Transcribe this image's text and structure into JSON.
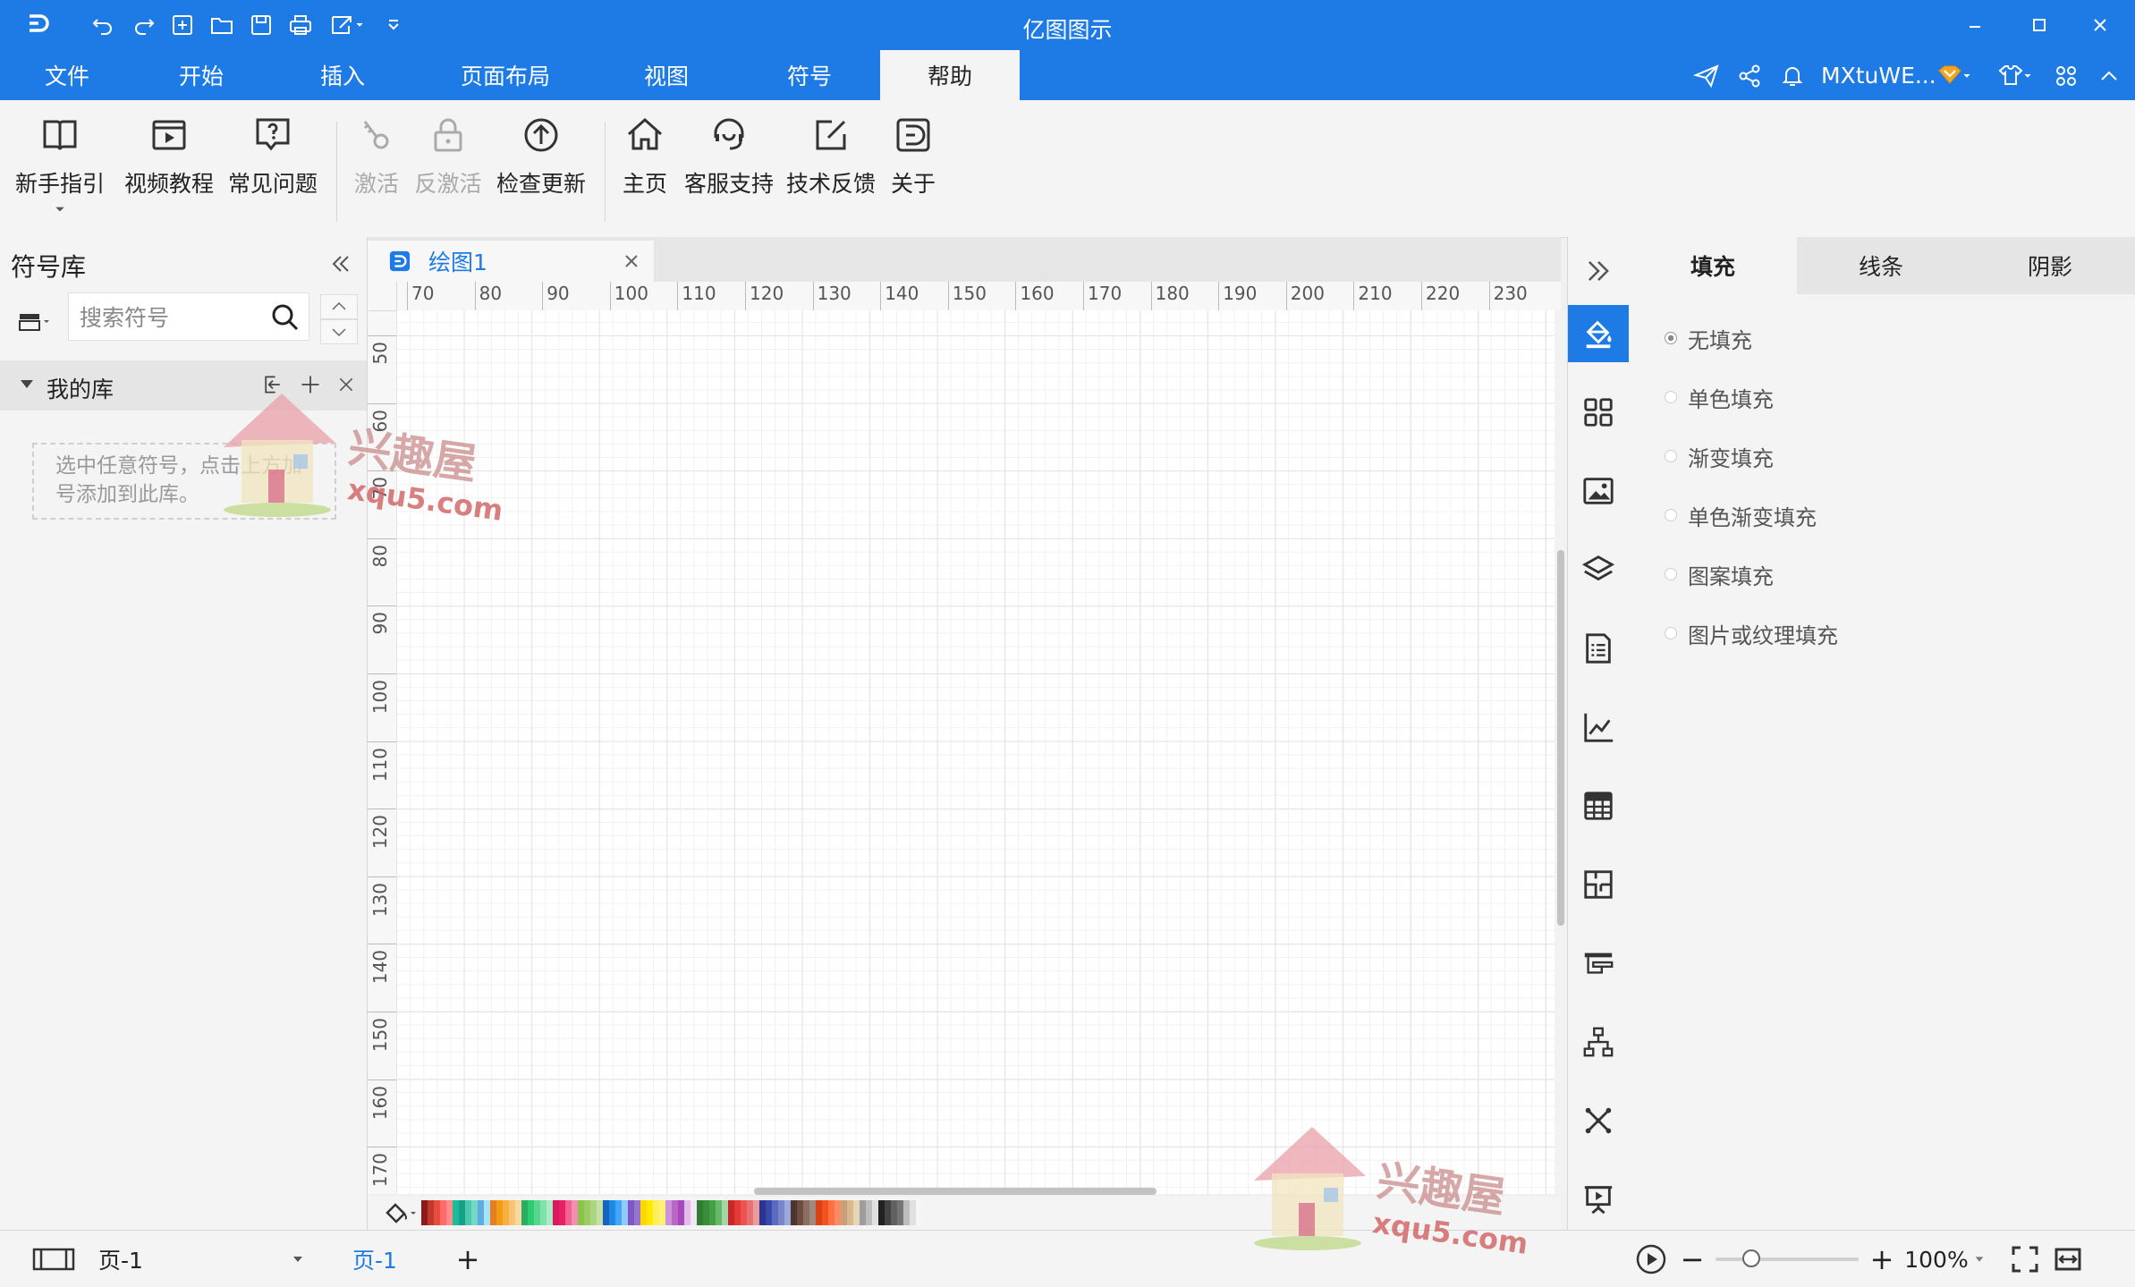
{
  "colors": {
    "accent": "#1e7be6",
    "panel_bg": "#f4f4f4",
    "ribbon_bg": "#f4f4f4"
  },
  "app_title": "亿图图示",
  "quick_access": [
    "app-logo-icon",
    "undo-icon",
    "redo-icon",
    "new-icon",
    "open-icon",
    "save-icon",
    "print-icon",
    "export-icon",
    "customize-icon"
  ],
  "menu": {
    "tabs": [
      {
        "label": "文件"
      },
      {
        "label": "开始"
      },
      {
        "label": "插入"
      },
      {
        "label": "页面布局"
      },
      {
        "label": "视图"
      },
      {
        "label": "符号"
      },
      {
        "label": "帮助"
      }
    ],
    "active": "帮助"
  },
  "account": {
    "username": "MXtuWE..."
  },
  "ribbon": {
    "buttons": [
      {
        "label": "新手指引",
        "icon": "book-icon",
        "enabled": true
      },
      {
        "label": "视频教程",
        "icon": "video-icon",
        "enabled": true
      },
      {
        "label": "常见问题",
        "icon": "faq-icon",
        "enabled": true
      },
      {
        "label": "激活",
        "icon": "key-icon",
        "enabled": false
      },
      {
        "label": "反激活",
        "icon": "lock-icon",
        "enabled": false
      },
      {
        "label": "检查更新",
        "icon": "update-icon",
        "enabled": true
      },
      {
        "label": "主页",
        "icon": "home-icon",
        "enabled": true
      },
      {
        "label": "客服支持",
        "icon": "support-icon",
        "enabled": true
      },
      {
        "label": "技术反馈",
        "icon": "feedback-icon",
        "enabled": true
      },
      {
        "label": "关于",
        "icon": "about-icon",
        "enabled": true
      }
    ]
  },
  "symbol_library": {
    "title": "符号库",
    "search_placeholder": "搜索符号",
    "my_library": {
      "label": "我的库",
      "hint": "选中任意符号，点击上方加号添加到此库。"
    }
  },
  "document": {
    "tab_label": "绘图1",
    "h_ruler": [
      "70",
      "80",
      "90",
      "100",
      "110",
      "120",
      "130",
      "140",
      "150",
      "160",
      "170",
      "180",
      "190",
      "200",
      "210",
      "220",
      "230"
    ],
    "v_ruler": [
      "50",
      "60",
      "70",
      "80",
      "90",
      "100",
      "110",
      "120",
      "130",
      "140",
      "150",
      "160",
      "170"
    ]
  },
  "palette": [
    "#8b1a1a",
    "#c0392b",
    "#e74c3c",
    "#ff6b6b",
    "#ff8a8a",
    "#1abc9c",
    "#16a085",
    "#48c9b0",
    "#76d7c4",
    "#5dade2",
    "#a3e4f7",
    "#e67e22",
    "#f39c12",
    "#f5b041",
    "#f8c471",
    "#fad7a0",
    "#27ae60",
    "#2ecc71",
    "#58d68d",
    "#82e0aa",
    "#abebc6",
    "#d81b60",
    "#e91e63",
    "#f06292",
    "#f48fb1",
    "#8bc34a",
    "#9ccc65",
    "#aed581",
    "#c5e1a5",
    "#1565c0",
    "#1e88e5",
    "#42a5f5",
    "#90caf9",
    "#7e57c2",
    "#9575cd",
    "#ffd600",
    "#ffea00",
    "#ffee58",
    "#fff176",
    "#ce93d8",
    "#ba68c8",
    "#ab47bc",
    "#e1bee7",
    "#f3e5f5",
    "#2e7d32",
    "#388e3c",
    "#43a047",
    "#66bb6a",
    "#a5d6a7",
    "#c62828",
    "#e53935",
    "#ef5350",
    "#e57373",
    "#ef9a9a",
    "#283593",
    "#3949ab",
    "#5c6bc0",
    "#7986cb",
    "#9fa8da",
    "#4e342e",
    "#6d4c41",
    "#8d6e63",
    "#a1887f",
    "#d84315",
    "#f4511e",
    "#ff7043",
    "#ff8a65",
    "#c6a07b",
    "#d7b98e",
    "#e8d5b5",
    "#9e9e9e",
    "#bdbdbd",
    "#e0e0e0",
    "#212121",
    "#424242",
    "#616161",
    "#757575",
    "#bdbdbd",
    "#e0e0e0",
    "#f5f5f5"
  ],
  "right_strip": [
    "fill-icon",
    "layout-icon",
    "image-icon",
    "layers-icon",
    "page-icon",
    "chart-icon",
    "table-icon",
    "floorplan-icon",
    "outline-icon",
    "org-icon",
    "connector-icon",
    "presentation-icon"
  ],
  "properties": {
    "tabs": [
      {
        "label": "填充"
      },
      {
        "label": "线条"
      },
      {
        "label": "阴影"
      }
    ],
    "active_tab": "填充",
    "fill_options": [
      {
        "label": "无填充",
        "selected": true
      },
      {
        "label": "单色填充",
        "selected": false
      },
      {
        "label": "渐变填充",
        "selected": false
      },
      {
        "label": "单色渐变填充",
        "selected": false
      },
      {
        "label": "图案填充",
        "selected": false
      },
      {
        "label": "图片或纹理填充",
        "selected": false
      }
    ]
  },
  "statusbar": {
    "page_select": "页-1",
    "page_tab": "页-1",
    "add_page": "+",
    "zoom": "100%",
    "zoom_out": "−",
    "zoom_in": "+",
    "zoom_level": 0.25
  },
  "watermark": {
    "text": "兴趣屋",
    "url": "xqu5.com"
  }
}
